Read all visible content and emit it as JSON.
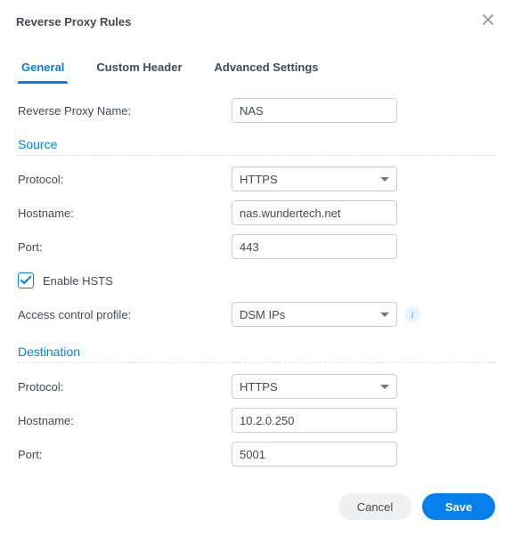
{
  "dialog": {
    "title": "Reverse Proxy Rules"
  },
  "tabs": {
    "general": {
      "label": "General"
    },
    "custom": {
      "label": "Custom Header"
    },
    "advanced": {
      "label": "Advanced Settings"
    }
  },
  "fields": {
    "name": {
      "label": "Reverse Proxy Name:",
      "value": "NAS"
    }
  },
  "source": {
    "title": "Source",
    "protocol": {
      "label": "Protocol:",
      "value": "HTTPS"
    },
    "hostname": {
      "label": "Hostname:",
      "value": "nas.wundertech.net"
    },
    "port": {
      "label": "Port:",
      "value": "443"
    },
    "hsts": {
      "label": "Enable HSTS",
      "checked": true
    },
    "acp": {
      "label": "Access control profile:",
      "value": "DSM IPs"
    }
  },
  "destination": {
    "title": "Destination",
    "protocol": {
      "label": "Protocol:",
      "value": "HTTPS"
    },
    "hostname": {
      "label": "Hostname:",
      "value": "10.2.0.250"
    },
    "port": {
      "label": "Port:",
      "value": "5001"
    }
  },
  "buttons": {
    "cancel": "Cancel",
    "save": "Save"
  },
  "icons": {
    "info": "i"
  }
}
